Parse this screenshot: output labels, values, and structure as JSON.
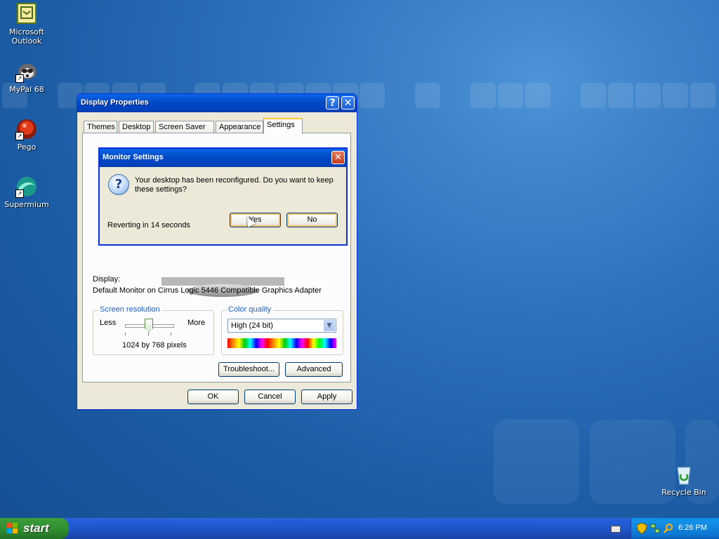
{
  "desktop": {
    "icons": [
      {
        "label": "Microsoft Outlook"
      },
      {
        "label": "MyPal 68"
      },
      {
        "label": "Pego"
      },
      {
        "label": "Supermium"
      },
      {
        "label": "Recycle Bin"
      }
    ]
  },
  "window": {
    "title": "Display Properties",
    "help_symbol": "?",
    "close_symbol": "✕",
    "tabs": [
      "Themes",
      "Desktop",
      "Screen Saver",
      "Appearance",
      "Settings"
    ],
    "active_tab": "Settings",
    "display_label": "Display:",
    "display_value": "Default Monitor on Cirrus Logic 5446 Compatible Graphics Adapter",
    "resolution": {
      "title": "Screen resolution",
      "less": "Less",
      "more": "More",
      "value": "1024 by 768 pixels"
    },
    "color_quality": {
      "title": "Color quality",
      "selected": "High (24 bit)"
    },
    "buttons": {
      "troubleshoot": "Troubleshoot...",
      "advanced": "Advanced",
      "ok": "OK",
      "cancel": "Cancel",
      "apply": "Apply"
    }
  },
  "dialog": {
    "title": "Monitor Settings",
    "message": "Your desktop has been reconfigured.  Do you want to keep these settings?",
    "countdown": "Reverting in 14 seconds",
    "yes": "Yes",
    "no": "No",
    "close_symbol": "✕"
  },
  "taskbar": {
    "start_label": "start",
    "clock": "6:26 PM"
  },
  "colors": {
    "desktop_blue": "#1c5da6",
    "titlebar_blue": "#0042bf",
    "start_green": "#2e8b2e"
  }
}
